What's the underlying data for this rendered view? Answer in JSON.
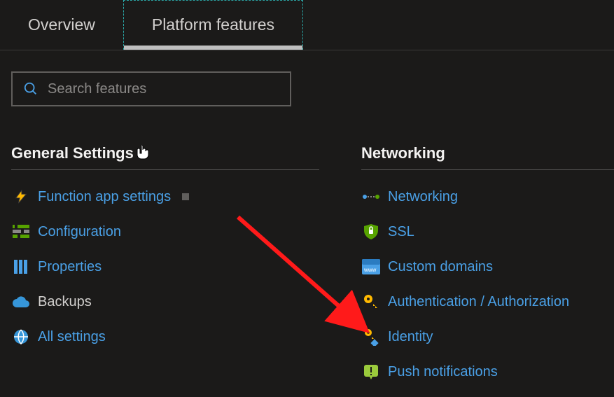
{
  "tabs": {
    "overview": "Overview",
    "platform_features": "Platform features"
  },
  "search": {
    "placeholder": "Search features"
  },
  "sections": {
    "general": {
      "heading": "General Settings",
      "items": [
        {
          "label": "Function app settings"
        },
        {
          "label": "Configuration"
        },
        {
          "label": "Properties"
        },
        {
          "label": "Backups"
        },
        {
          "label": "All settings"
        }
      ]
    },
    "networking": {
      "heading": "Networking",
      "items": [
        {
          "label": "Networking"
        },
        {
          "label": "SSL"
        },
        {
          "label": "Custom domains"
        },
        {
          "label": "Authentication / Authorization"
        },
        {
          "label": "Identity"
        },
        {
          "label": "Push notifications"
        }
      ]
    }
  }
}
